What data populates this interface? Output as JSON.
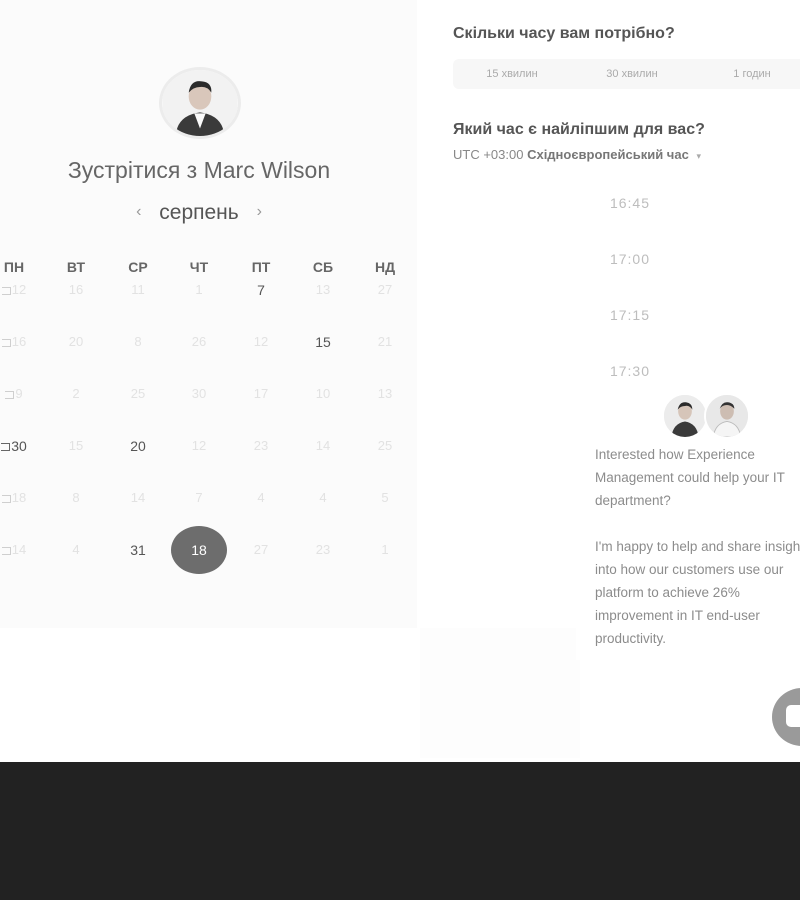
{
  "booking": {
    "title": "Зустрітися з Marc Wilson",
    "month": "серпень",
    "prev_arrow": "‹",
    "next_arrow": "›",
    "weekdays": [
      "ПН",
      "ВТ",
      "СР",
      "ЧТ",
      "ПТ",
      "СБ",
      "НД"
    ],
    "weeks": [
      [
        "12",
        "16",
        "11",
        "1",
        "7",
        "13",
        "27"
      ],
      [
        "16",
        "20",
        "8",
        "26",
        "12",
        "15",
        "21"
      ],
      [
        "9",
        "2",
        "25",
        "30",
        "17",
        "10",
        "13"
      ],
      [
        "30",
        "15",
        "20",
        "12",
        "23",
        "14",
        "25"
      ],
      [
        "18",
        "8",
        "14",
        "7",
        "4",
        "4",
        "5"
      ],
      [
        "14",
        "4",
        "31",
        "18",
        "27",
        "23",
        "1"
      ]
    ],
    "available_days": [
      "7",
      "15",
      "20",
      "30",
      "31"
    ],
    "selected_day": "18"
  },
  "duration": {
    "question": "Скільки часу вам потрібно?",
    "options": [
      "15 хвилин",
      "30 хвилин",
      "1 годин"
    ]
  },
  "time": {
    "question": "Який час є найліпшим для вас?",
    "tz_prefix": "UTC +03:00",
    "tz_name": "Східноєвропейський час",
    "tz_caret": "▾",
    "slots": [
      "16:45",
      "17:00",
      "17:15",
      "17:30"
    ]
  },
  "chat": {
    "message": "Interested how Experience Management could help your IT department?\n\nI'm happy to help and share insight into how our customers use our platform to achieve 26% improvement in IT end-user productivity."
  },
  "colors": {
    "selected_day": "#6d6d6d",
    "footer": "#222222",
    "panel_bg": "#fbfbfb"
  },
  "icons": {
    "prev": "chevron-left-icon",
    "next": "chevron-right-icon",
    "chat": "chat-bubble-icon",
    "calendar": "calendar-icon"
  }
}
